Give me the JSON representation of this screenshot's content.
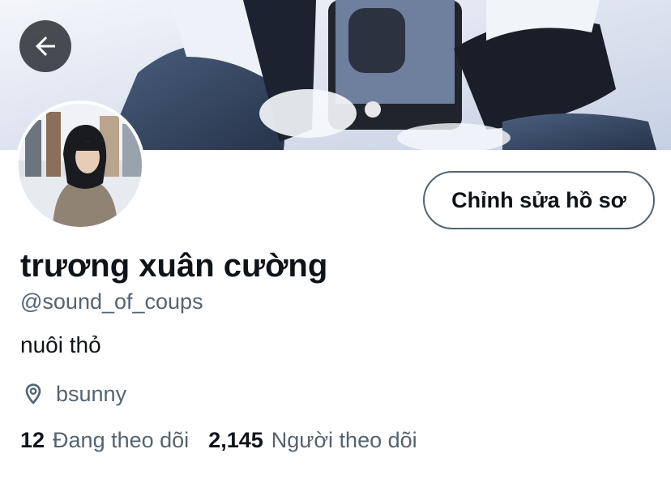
{
  "header": {
    "back_icon": "arrow-left-icon",
    "banner_image": "cover-photo-sneakers-in-snow"
  },
  "profile": {
    "avatar_image": "person-in-black-hood-snowy-street",
    "edit_button_label": "Chỉnh sửa hồ sơ",
    "display_name": "trương xuân cường",
    "handle": "@sound_of_coups",
    "bio": "nuôi thỏ",
    "location_icon": "location-pin-icon",
    "location": "bsunny"
  },
  "stats": {
    "following_count": "12",
    "following_label": "Đang theo dõi",
    "followers_count": "2,145",
    "followers_label": "Người theo dõi"
  },
  "colors": {
    "text_primary": "#0f1419",
    "text_secondary": "#536471",
    "button_border": "#536471"
  }
}
